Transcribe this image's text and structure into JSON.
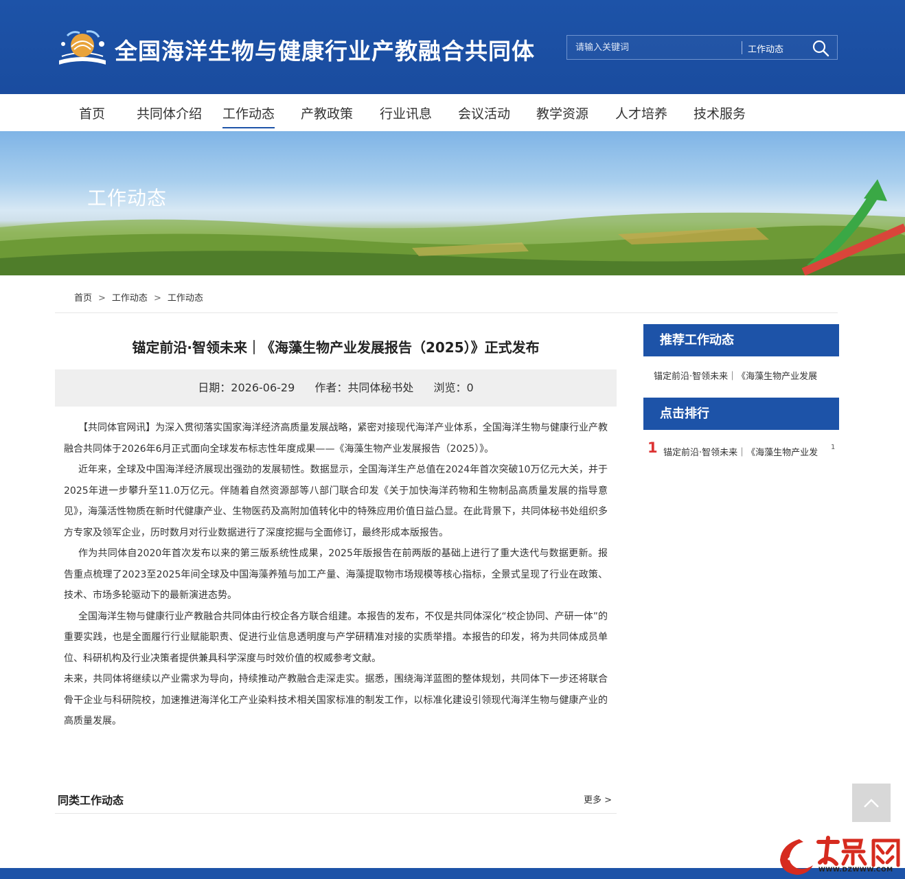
{
  "header": {
    "site_title": "全国海洋生物与健康行业产教融合共同体",
    "search": {
      "placeholder": "请输入关键词",
      "category": "工作动态"
    }
  },
  "nav": {
    "items": [
      {
        "label": "首页"
      },
      {
        "label": "共同体介绍"
      },
      {
        "label": "工作动态",
        "active": true
      },
      {
        "label": "产教政策"
      },
      {
        "label": "行业讯息"
      },
      {
        "label": "会议活动"
      },
      {
        "label": "教学资源"
      },
      {
        "label": "人才培养"
      },
      {
        "label": "技术服务"
      }
    ]
  },
  "banner": {
    "title": "工作动态"
  },
  "breadcrumb": {
    "items": [
      "首页",
      "工作动态",
      "工作动态"
    ],
    "separator": ">"
  },
  "article": {
    "title": "锚定前沿·智领未来｜《海藻生物产业发展报告（2025）》正式发布",
    "meta": {
      "date": "日期：2026-06-29",
      "author": "作者：共同体秘书处",
      "views": "浏览：0"
    },
    "paragraphs": [
      "【共同体官网讯】为深入贯彻落实国家海洋经济高质量发展战略，紧密对接现代海洋产业体系，全国海洋生物与健康行业产教融合共同体于2026年6月正式面向全球发布标志性年度成果——《海藻生物产业发展报告（2025）》。",
      "近年来，全球及中国海洋经济展现出强劲的发展韧性。数据显示，全国海洋生产总值在2024年首次突破10万亿元大关，并于2025年进一步攀升至11.0万亿元。伴随着自然资源部等八部门联合印发《关于加快海洋药物和生物制品高质量发展的指导意见》，海藻活性物质在新时代健康产业、生物医药及高附加值转化中的特殊应用价值日益凸显。在此背景下，共同体秘书处组织多方专家及领军企业，历时数月对行业数据进行了深度挖掘与全面修订，最终形成本版报告。",
      "作为共同体自2020年首次发布以来的第三版系统性成果，2025年版报告在前两版的基础上进行了重大迭代与数据更新。报告重点梳理了2023至2025年间全球及中国海藻养殖与加工产量、海藻提取物市场规模等核心指标，全景式呈现了行业在政策、技术、市场多轮驱动下的最新演进态势。",
      "全国海洋生物与健康行业产教融合共同体由行校企各方联合组建。本报告的发布，不仅是共同体深化“校企协同、产研一体”的重要实践，也是全面履行行业赋能职责、促进行业信息透明度与产学研精准对接的实质举措。本报告的印发，将为共同体成员单位、科研机构及行业决策者提供兼具科学深度与时效价值的权威参考文献。",
      "未来，共同体将继续以产业需求为导向，持续推动产教融合走深走实。据悉，围绕海洋蓝图的整体规划，共同体下一步还将联合骨干企业与科研院校，加速推进海洋化工产业染料技术相关国家标准的制发工作，以标准化建设引领现代海洋生物与健康产业的高质量发展。"
    ]
  },
  "related": {
    "title": "同类工作动态",
    "more": "更多 >"
  },
  "sidebar": {
    "recommend": {
      "title": "推荐工作动态",
      "items": [
        "锚定前沿·智领未来｜《海藻生物产业发展"
      ]
    },
    "ranking": {
      "title": "点击排行",
      "items": [
        {
          "rank": "1",
          "label": "锚定前沿·智领未来｜《海藻生物产业发",
          "count": "1"
        }
      ]
    }
  },
  "watermark": {
    "text": "WWW.DZWWW.COM"
  },
  "colors": {
    "primary": "#1d53a8",
    "rank": "#dd3333",
    "meta_bg": "#efefef"
  },
  "icons": [
    "logo-emblem-icon",
    "search-icon",
    "back-to-top-icon",
    "watermark-logo-icon"
  ]
}
